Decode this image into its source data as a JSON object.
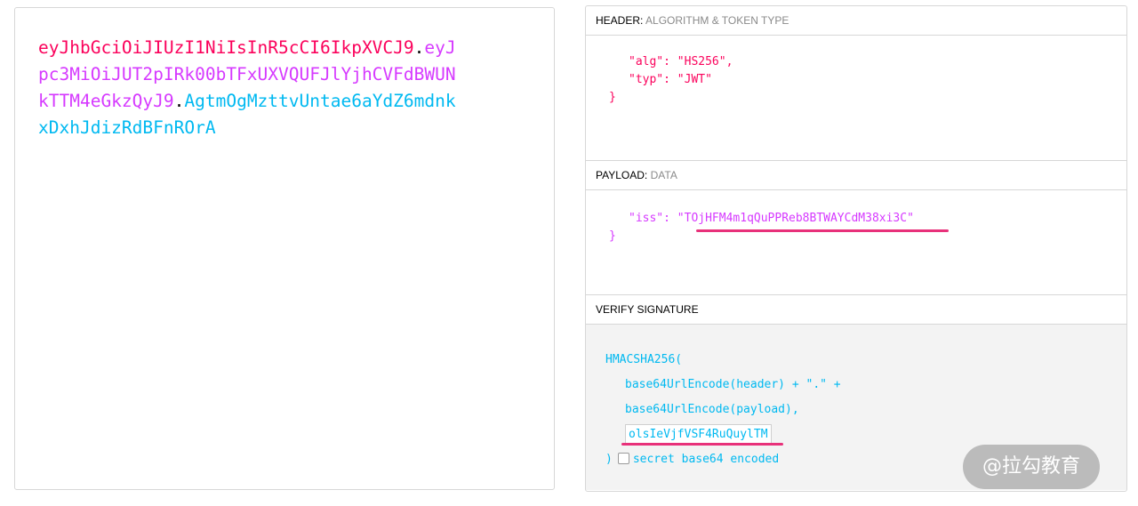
{
  "encoded": {
    "line1": {
      "header": "eyJhbGciOiJIUzI1NiIsInR5cCI6IkpXVCJ9",
      "dot": ".",
      "payload": "eyJ"
    },
    "line2": {
      "payload": "pc3MiOiJUT2pIRk00bTFxUXVQUFJlYjhCVFdBWUN"
    },
    "line3": {
      "payload": "kTTM4eGkzQyJ9",
      "dot": ".",
      "signature": "AgtmOgMzttvUntae6aYdZ6mdnk"
    },
    "line4": {
      "signature": "xDxhJdizRdBFnROrA"
    }
  },
  "header_section": {
    "title": "HEADER:",
    "subtitle": "ALGORITHM & TOKEN TYPE",
    "lines": [
      "\"alg\": \"HS256\",",
      "\"typ\": \"JWT\""
    ],
    "close": "}"
  },
  "payload_section": {
    "title": "PAYLOAD:",
    "subtitle": "DATA",
    "key": "\"iss\": ",
    "value": "\"TOjHFM4m1qQuPPReb8BTWAYCdM38xi3C\"",
    "close": "}"
  },
  "signature_section": {
    "title": "VERIFY SIGNATURE",
    "func": "HMACSHA256(",
    "line_header": "base64UrlEncode(header) + \".\" +",
    "line_payload": "base64UrlEncode(payload),",
    "secret_value": "olsIeVjfVSF4RuQuylTM",
    "close": ")",
    "checkbox_label": "secret base64 encoded"
  },
  "watermark": "@拉勾教育",
  "colors": {
    "header": "#fb015b",
    "payload": "#d63aff",
    "signature": "#00b9f1",
    "highlight": "#e8317a"
  }
}
